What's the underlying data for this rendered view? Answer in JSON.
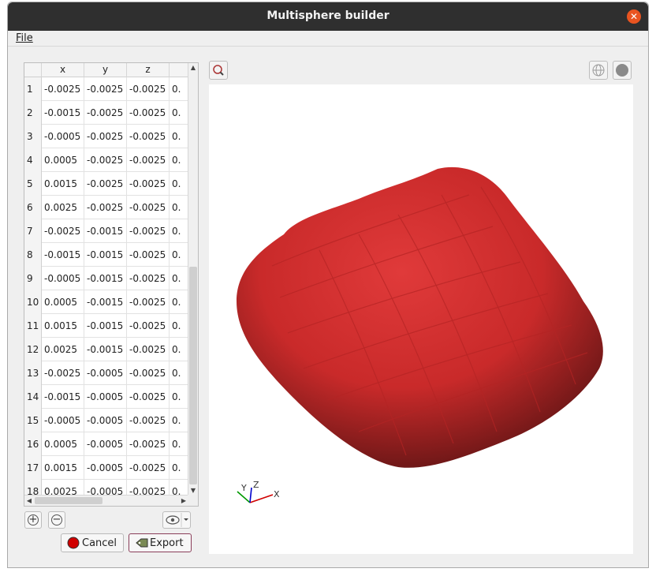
{
  "window": {
    "title": "Multisphere builder"
  },
  "menu": {
    "file_label": "File"
  },
  "table": {
    "columns": [
      "x",
      "y",
      "z"
    ],
    "rows": [
      {
        "n": "1",
        "x": "-0.0025",
        "y": "-0.0025",
        "z": "-0.0025",
        "r": "0."
      },
      {
        "n": "2",
        "x": "-0.0015",
        "y": "-0.0025",
        "z": "-0.0025",
        "r": "0."
      },
      {
        "n": "3",
        "x": "-0.0005",
        "y": "-0.0025",
        "z": "-0.0025",
        "r": "0."
      },
      {
        "n": "4",
        "x": "0.0005",
        "y": "-0.0025",
        "z": "-0.0025",
        "r": "0."
      },
      {
        "n": "5",
        "x": "0.0015",
        "y": "-0.0025",
        "z": "-0.0025",
        "r": "0."
      },
      {
        "n": "6",
        "x": "0.0025",
        "y": "-0.0025",
        "z": "-0.0025",
        "r": "0."
      },
      {
        "n": "7",
        "x": "-0.0025",
        "y": "-0.0015",
        "z": "-0.0025",
        "r": "0."
      },
      {
        "n": "8",
        "x": "-0.0015",
        "y": "-0.0015",
        "z": "-0.0025",
        "r": "0."
      },
      {
        "n": "9",
        "x": "-0.0005",
        "y": "-0.0015",
        "z": "-0.0025",
        "r": "0."
      },
      {
        "n": "10",
        "x": "0.0005",
        "y": "-0.0015",
        "z": "-0.0025",
        "r": "0."
      },
      {
        "n": "11",
        "x": "0.0015",
        "y": "-0.0015",
        "z": "-0.0025",
        "r": "0."
      },
      {
        "n": "12",
        "x": "0.0025",
        "y": "-0.0015",
        "z": "-0.0025",
        "r": "0."
      },
      {
        "n": "13",
        "x": "-0.0025",
        "y": "-0.0005",
        "z": "-0.0025",
        "r": "0."
      },
      {
        "n": "14",
        "x": "-0.0015",
        "y": "-0.0005",
        "z": "-0.0025",
        "r": "0."
      },
      {
        "n": "15",
        "x": "-0.0005",
        "y": "-0.0005",
        "z": "-0.0025",
        "r": "0."
      },
      {
        "n": "16",
        "x": "0.0005",
        "y": "-0.0005",
        "z": "-0.0025",
        "r": "0."
      },
      {
        "n": "17",
        "x": "0.0015",
        "y": "-0.0005",
        "z": "-0.0025",
        "r": "0."
      },
      {
        "n": "18",
        "x": "0.0025",
        "y": "-0.0005",
        "z": "-0.0025",
        "r": "0."
      }
    ]
  },
  "buttons": {
    "add_icon": "plus-circle-icon",
    "remove_icon": "minus-circle-icon",
    "view_icon": "eye-icon",
    "cancel_label": "Cancel",
    "export_label": "Export"
  },
  "viewer": {
    "zoom_icon": "zoom-icon",
    "wireframe_icon": "globe-icon",
    "solid_icon": "sphere-icon",
    "axes": {
      "x": "X",
      "y": "Y",
      "z": "Z"
    },
    "shape_color": "#d32f2f"
  },
  "colors": {
    "titlebar": "#2f2f2f",
    "close": "#e95420"
  }
}
